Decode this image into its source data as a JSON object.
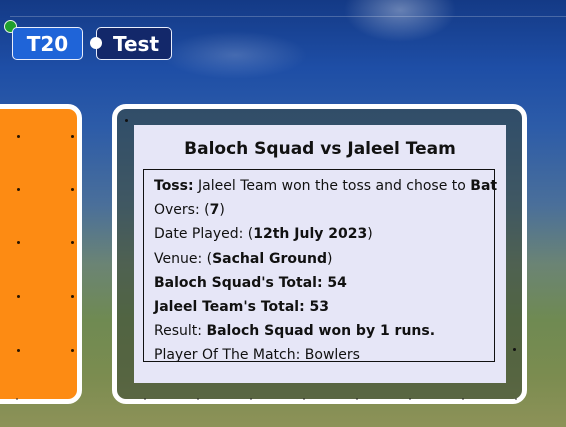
{
  "tabs": [
    {
      "label": "T20",
      "active": true
    },
    {
      "label": "Test",
      "active": false
    }
  ],
  "colors": {
    "active_tab": "#1f64d8",
    "inactive_tab": "#13286a",
    "side_card": "#fd8b13",
    "panel": "#e6e6f7",
    "indicator": "#1fa02d"
  },
  "match": {
    "title": "Baloch Squad vs Jaleel Team",
    "toss_label": "Toss:",
    "toss_text": " Jaleel Team won the toss and chose to ",
    "toss_choice": "Bat",
    "overs_label": "Overs: (",
    "overs_value": "7",
    "overs_close": ")",
    "date_label": "Date Played: (",
    "date_value": "12th July 2023",
    "date_close": ")",
    "venue_label": "Venue: (",
    "venue_value": "Sachal Ground",
    "venue_close": ")",
    "team1_total": "Baloch Squad's Total: 54",
    "team2_total": "Jaleel Team's Total: 53",
    "result_label": "Result: ",
    "result_value": "Baloch Squad won by 1 runs.",
    "potm_label": "Player Of The Match: ",
    "potm_value": "Bowlers"
  }
}
